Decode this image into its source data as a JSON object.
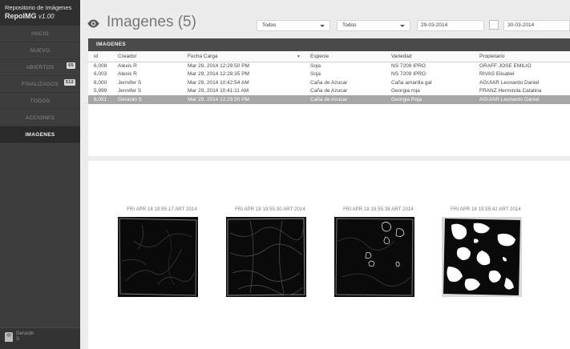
{
  "brand": {
    "line1": "Repositorio de Imágenes",
    "name": "RepoIMG",
    "version": "v1.00"
  },
  "sidebar": {
    "items": [
      {
        "label": "INICIO",
        "badge": "",
        "active": false
      },
      {
        "label": "NUEVO",
        "badge": "",
        "active": false
      },
      {
        "label": "ABIERTOS",
        "badge": "65",
        "active": false
      },
      {
        "label": "FINALIZADOS",
        "badge": "512",
        "active": false
      },
      {
        "label": "TODOS",
        "badge": "",
        "active": false
      },
      {
        "label": "ACCIONES",
        "badge": "",
        "active": false
      },
      {
        "label": "IMAGENES",
        "badge": "",
        "active": true
      }
    ]
  },
  "user": {
    "first": "Gerardo",
    "last": "S"
  },
  "header": {
    "title": "Imagenes (5)",
    "filter1": "Todos",
    "filter2": "Todos",
    "date_from": "29-03-2014",
    "date_to": "30-03-2014"
  },
  "grid": {
    "title": "IMAGENES",
    "columns": [
      "id",
      "Creador",
      "Fecha Carga",
      "Especie",
      "Variedad",
      "Propietario"
    ],
    "rows": [
      [
        "6,008",
        "Alexis R",
        "Mar 29, 2014 12:29:50 PM",
        "Soja",
        "NS 7209 IPRO",
        "GRAFF JOSE EMILIO"
      ],
      [
        "6,003",
        "Alexis R",
        "Mar 29, 2014 12:28:35 PM",
        "Soja",
        "NS 7209 IPRO",
        "RIVAS Elisabel"
      ],
      [
        "6,000",
        "Jennifer S",
        "Mar 29, 2014 10:42:54 AM",
        "Caña de Azucar",
        "Caña amarilla gal",
        "AGUIAR Leonardo Daniel"
      ],
      [
        "5,999",
        "Jennifer S",
        "Mar 29, 2014 10:41:11 AM",
        "Caña de Azucar",
        "Georgia roja",
        "FRANZ Herminda Catalina"
      ],
      [
        "6,051",
        "Gerardo S",
        "Mar 29, 2014 12:29:50 PM",
        "Caña de Azucar",
        "Georgia Roja",
        "AGUIAR Leonardo Daniel"
      ]
    ],
    "selected_row": 4
  },
  "gallery": [
    {
      "caption": "FRI APR 18 19:55:17 ART 2014"
    },
    {
      "caption": "FRI APR 18 19:55:30 ART 2014"
    },
    {
      "caption": "FRI APR 18 19:55:38 ART 2014"
    },
    {
      "caption": "FRI APR 18 19:55:42 ART 2014"
    }
  ],
  "icons": {
    "eye": "eye-icon",
    "avatar": "user-avatar-icon",
    "calendar": "date-checkbox"
  }
}
